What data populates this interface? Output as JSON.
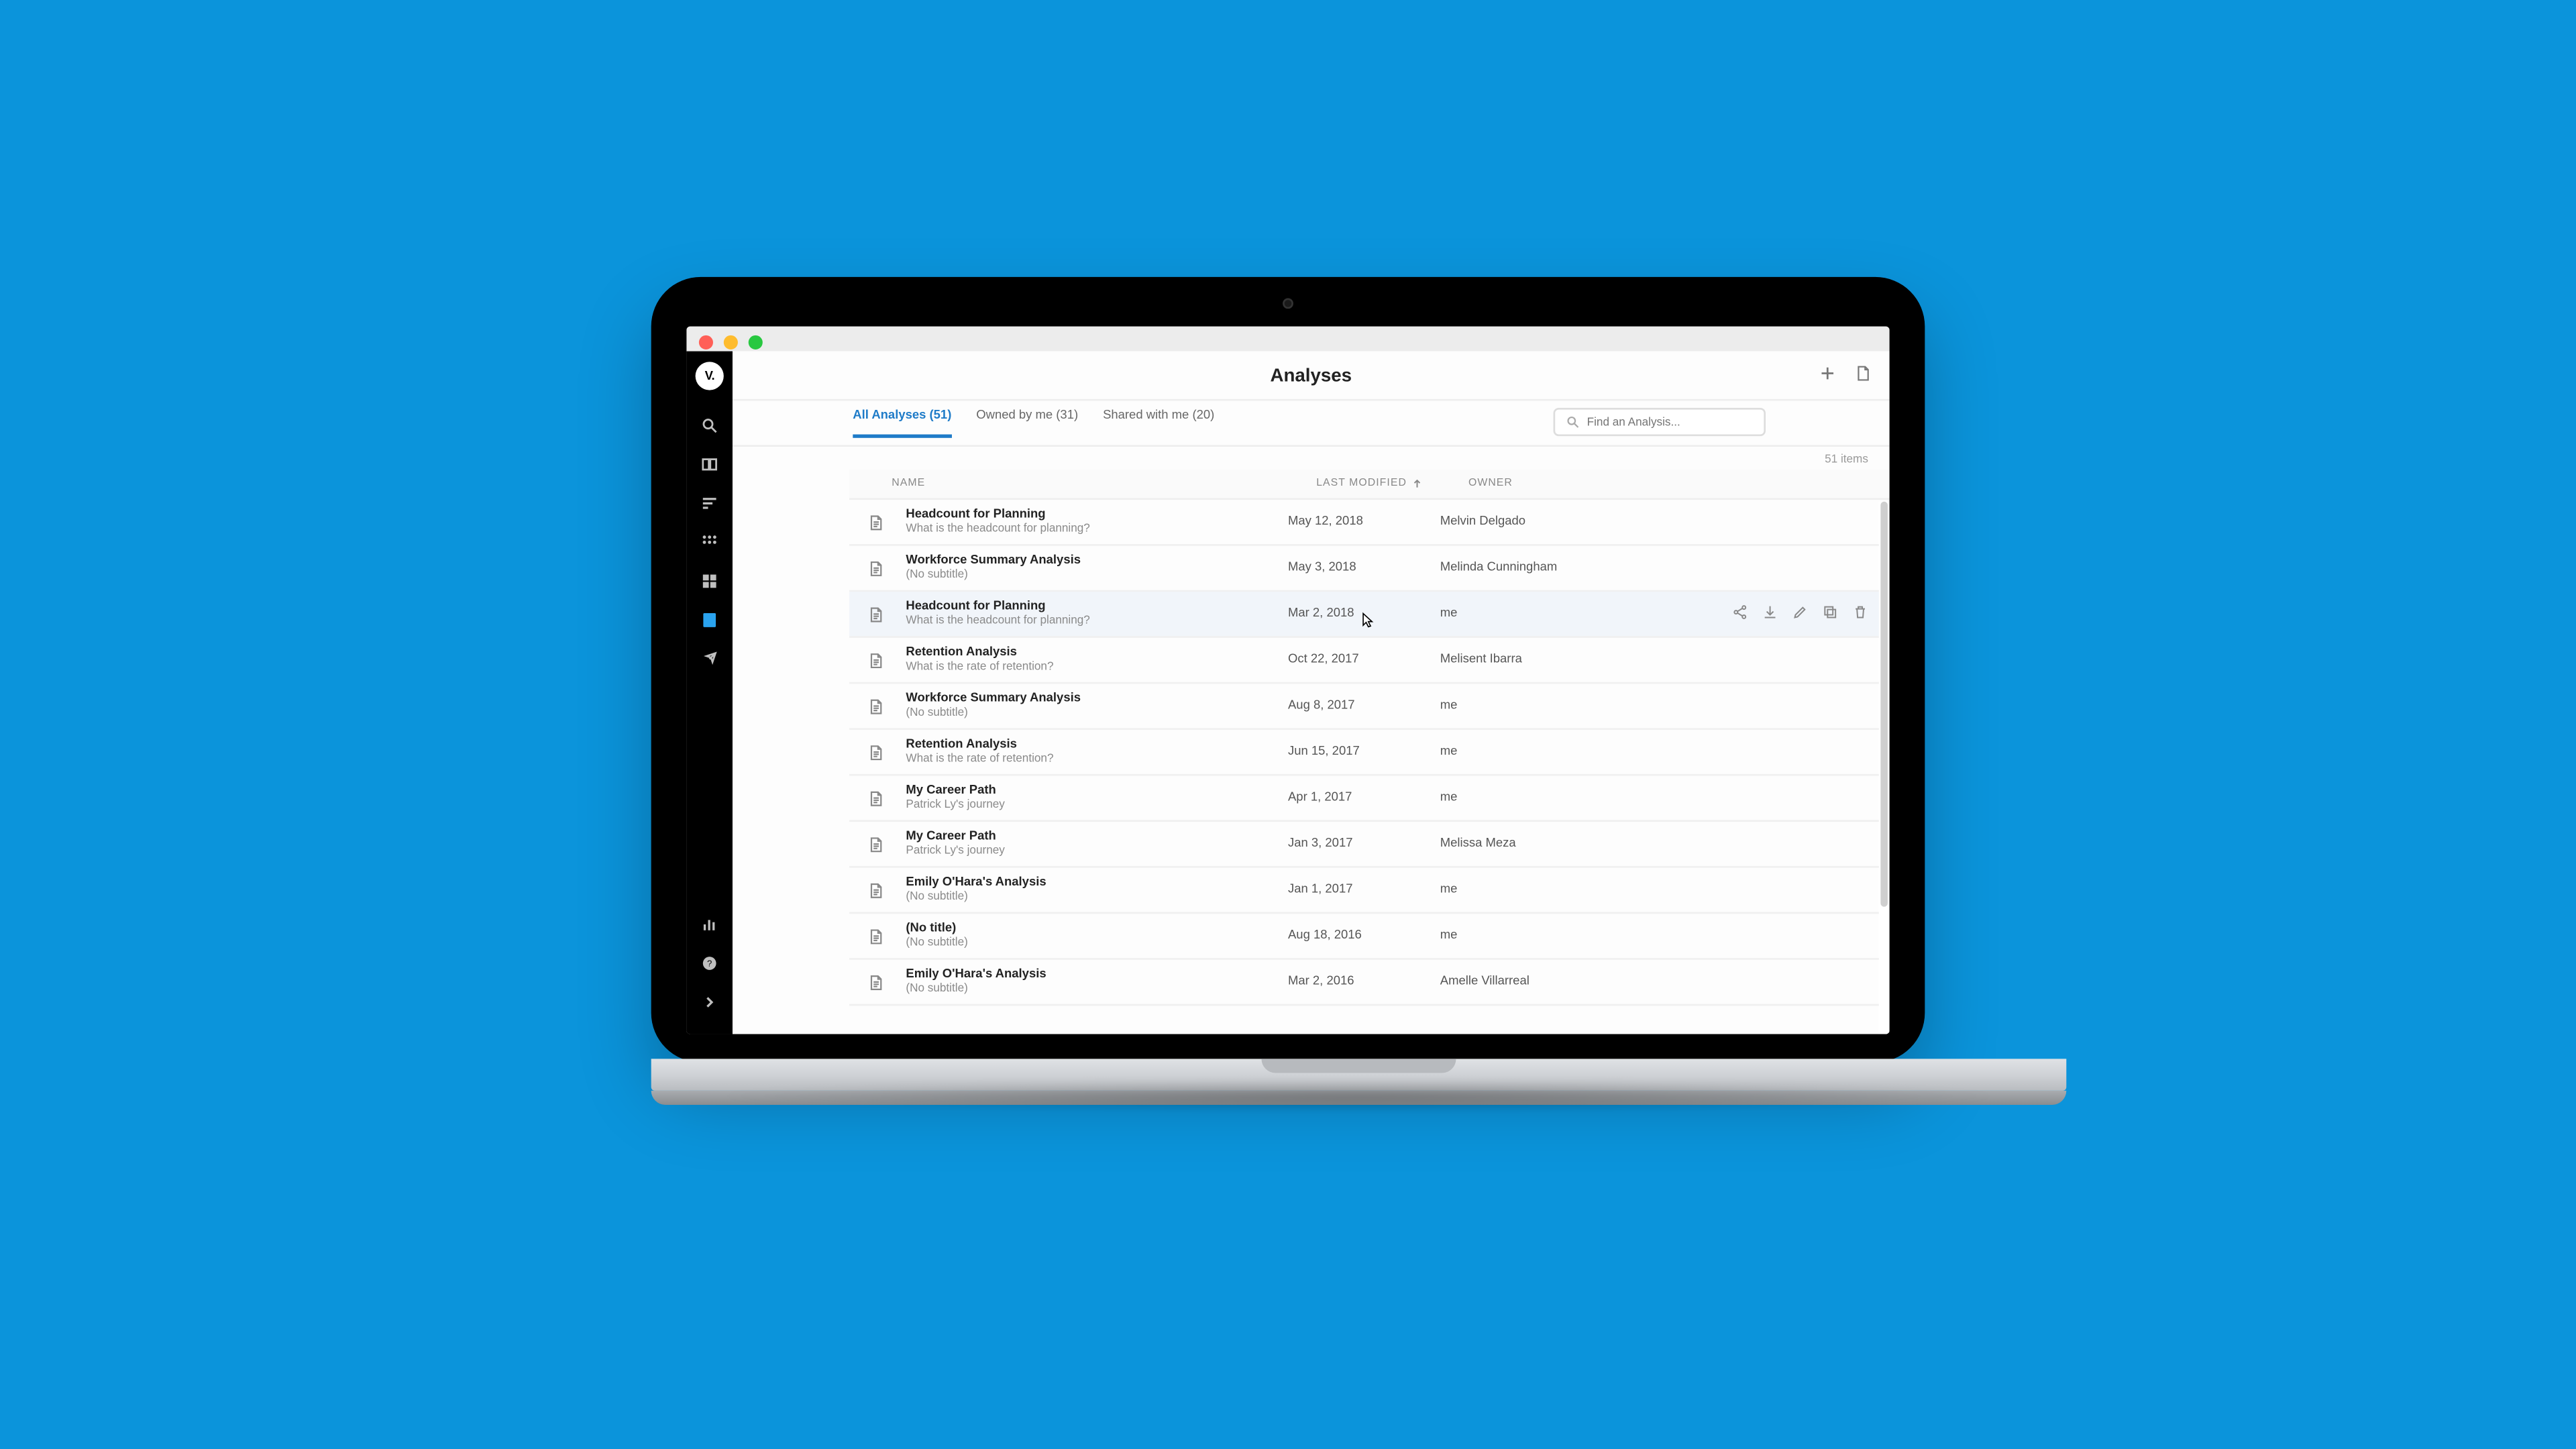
{
  "page": {
    "title": "Analyses",
    "item_count_label": "51 items"
  },
  "avatar_initials": "V.",
  "tabs": [
    {
      "label": "All Analyses (51)",
      "active": true
    },
    {
      "label": "Owned by me (31)",
      "active": false
    },
    {
      "label": "Shared with me (20)",
      "active": false
    }
  ],
  "search": {
    "placeholder": "Find an Analysis..."
  },
  "columns": {
    "name": "NAME",
    "modified": "LAST MODIFIED",
    "owner": "OWNER"
  },
  "sort": {
    "column": "LAST MODIFIED",
    "direction": "asc"
  },
  "hovered_row_index": 2,
  "rows": [
    {
      "title": "Headcount for Planning",
      "subtitle": "What is the headcount for planning?",
      "modified": "May 12, 2018",
      "owner": "Melvin Delgado"
    },
    {
      "title": "Workforce Summary Analysis",
      "subtitle": "(No subtitle)",
      "modified": "May 3, 2018",
      "owner": "Melinda Cunningham"
    },
    {
      "title": "Headcount for Planning",
      "subtitle": "What is the headcount for planning?",
      "modified": "Mar 2, 2018",
      "owner": "me"
    },
    {
      "title": "Retention Analysis",
      "subtitle": "What is the rate of retention?",
      "modified": "Oct 22, 2017",
      "owner": "Melisent Ibarra"
    },
    {
      "title": "Workforce Summary Analysis",
      "subtitle": "(No subtitle)",
      "modified": "Aug 8, 2017",
      "owner": "me"
    },
    {
      "title": "Retention Analysis",
      "subtitle": "What is the rate of retention?",
      "modified": "Jun 15, 2017",
      "owner": "me"
    },
    {
      "title": "My Career Path",
      "subtitle": "Patrick Ly's journey",
      "modified": "Apr 1, 2017",
      "owner": "me"
    },
    {
      "title": "My Career Path",
      "subtitle": "Patrick Ly's journey",
      "modified": "Jan 3, 2017",
      "owner": "Melissa Meza"
    },
    {
      "title": "Emily O'Hara's Analysis",
      "subtitle": "(No subtitle)",
      "modified": "Jan 1, 2017",
      "owner": "me"
    },
    {
      "title": "(No title)",
      "subtitle": "(No subtitle)",
      "modified": "Aug 18, 2016",
      "owner": "me"
    },
    {
      "title": "Emily O'Hara's Analysis",
      "subtitle": "(No subtitle)",
      "modified": "Mar 2, 2016",
      "owner": "Amelle Villarreal"
    }
  ],
  "row_actions": {
    "share": "share-icon",
    "download": "download-icon",
    "edit": "edit-icon",
    "duplicate": "duplicate-icon",
    "delete": "delete-icon"
  },
  "sidebar_icons": [
    "search-icon",
    "guide-icon",
    "sort-descending-icon",
    "pivot-icon",
    "dashboard-icon",
    "analyses-icon",
    "capture-icon"
  ],
  "sidebar_foot_icons": [
    "chart-icon",
    "help-icon",
    "expand-icon"
  ],
  "header_actions": [
    "add-icon",
    "new-doc-icon"
  ]
}
